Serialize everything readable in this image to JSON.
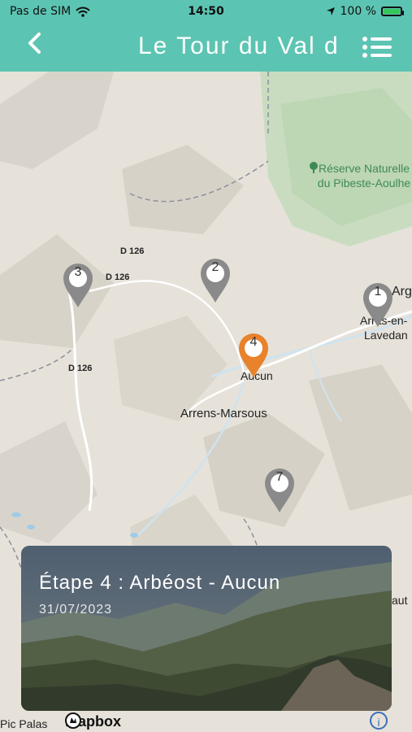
{
  "status_bar": {
    "carrier": "Pas de SIM",
    "time": "14:50",
    "battery_percent": "100 %"
  },
  "header": {
    "title": "Le Tour du Val d"
  },
  "map": {
    "place_labels": {
      "reserve": "Réserve Naturelle\ndu Pibeste-Aoulhe",
      "arrens": "Arrens-Marsous",
      "aucun": "Aucun",
      "argeles": "Arg",
      "arras": "Arras-en-",
      "lavedan": "Lavedan",
      "pic_palas": "Pic Palas",
      "right_edge": "aut"
    },
    "roads": [
      "D 126",
      "D 126",
      "D 126"
    ],
    "markers": [
      {
        "number": "1",
        "color": "#8a8a8a"
      },
      {
        "number": "2",
        "color": "#8a8a8a"
      },
      {
        "number": "3",
        "color": "#8a8a8a"
      },
      {
        "number": "4",
        "color": "#e8822b",
        "selected": true
      },
      {
        "number": "7",
        "color": "#8a8a8a"
      }
    ],
    "attribution": "mapbox"
  },
  "card": {
    "title": "Étape 4 : Arbéost - Aucun",
    "date": "31/07/2023"
  },
  "colors": {
    "header_bg": "#5cc4b2",
    "selected_marker": "#e8822b",
    "marker": "#8a8a8a"
  }
}
